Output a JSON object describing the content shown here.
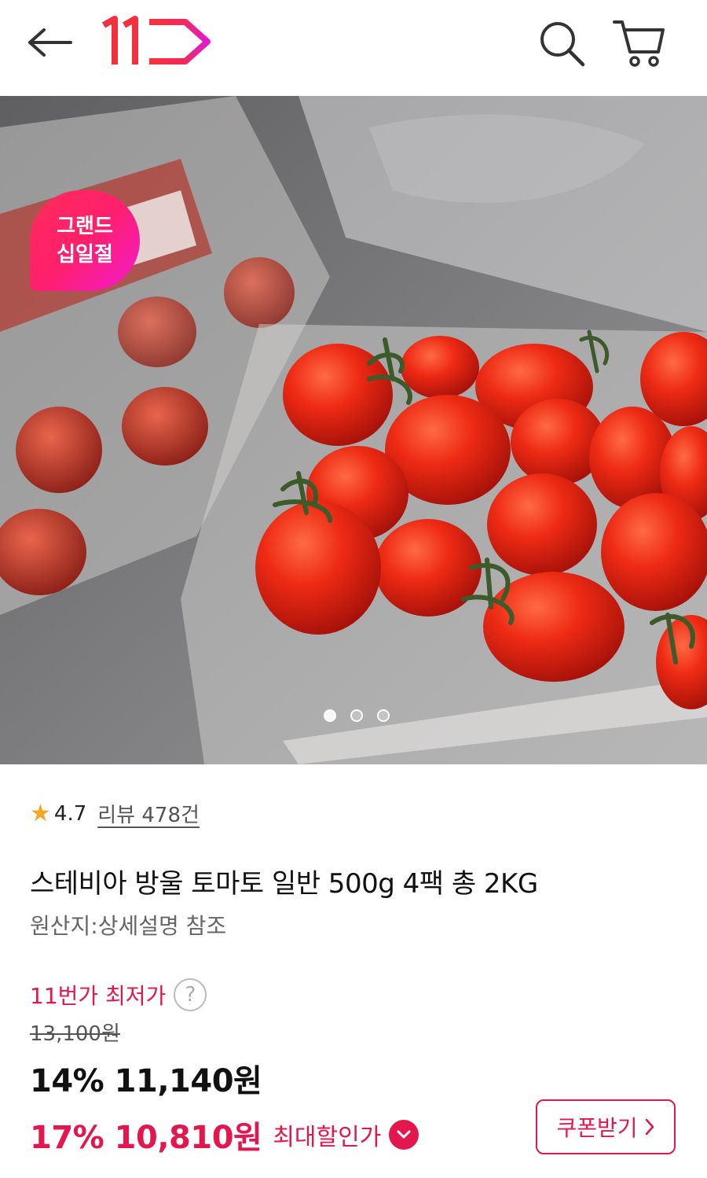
{
  "header": {
    "logo_text": "11",
    "logo_color": "#f02e4b",
    "icons": [
      "back-arrow-icon",
      "search-icon",
      "cart-icon"
    ]
  },
  "hero": {
    "badge_line1": "그랜드",
    "badge_line2": "십일절",
    "slides": 3,
    "active_slide": 1
  },
  "product": {
    "rating": "4.7",
    "review_label": "리뷰 478건",
    "title": "스테비아 방울 토마토 일반 500g 4팩 총 2KG",
    "origin": "원산지:상세설명 참조"
  },
  "price": {
    "lowest_label": "11번가 최저가",
    "help_symbol": "?",
    "original": "13,100원",
    "sale": "14% 11,140원",
    "max_discount": "17% 10,810원",
    "max_label": "최대할인가",
    "coupon_label": "쿠폰받기",
    "accent_color": "#e4164e"
  }
}
